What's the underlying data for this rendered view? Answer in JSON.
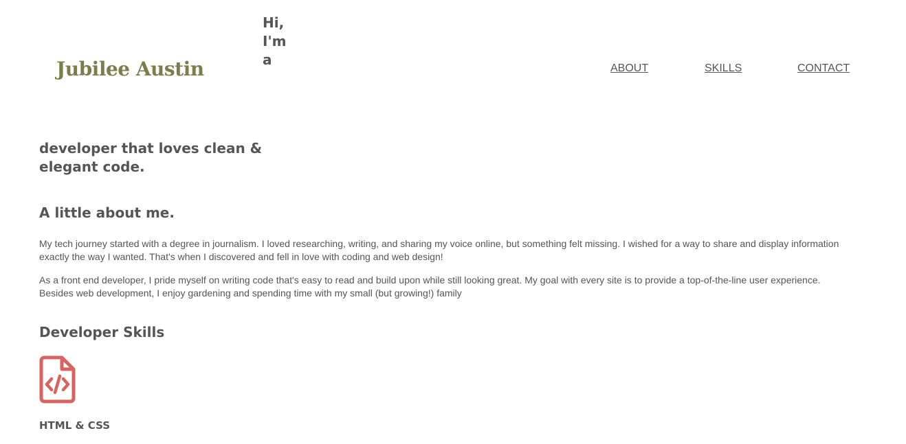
{
  "header": {
    "brand": "Jubilee Austin",
    "intro_top": [
      "Hi,",
      "I'm",
      "a"
    ],
    "nav": {
      "about": "ABOUT",
      "skills": "SKILLS",
      "contact": "CONTACT"
    }
  },
  "hero": {
    "intro_rest": "developer that loves clean & elegant code."
  },
  "about": {
    "heading": "A little about me.",
    "paragraphs": [
      "My tech journey started with a degree in journalism. I loved researching, writing, and sharing my voice online, but something felt missing. I wished for a way to share and display information exactly the way I wanted. That's when I discovered and fell in love with coding and web design!",
      "As a front end developer, I pride myself on writing code that's easy to read and build upon while still looking great. My goal with every site is to provide a top-of-the-line user experience. Besides web development, I enjoy gardening and spending time with my small (but growing!) family"
    ]
  },
  "skills": {
    "heading": "Developer Skills",
    "items": [
      {
        "icon": "file-code-icon",
        "label": "HTML & CSS"
      }
    ]
  },
  "colors": {
    "brand": "#7b7d4a",
    "text": "#555555",
    "icon": "#d9645f"
  }
}
